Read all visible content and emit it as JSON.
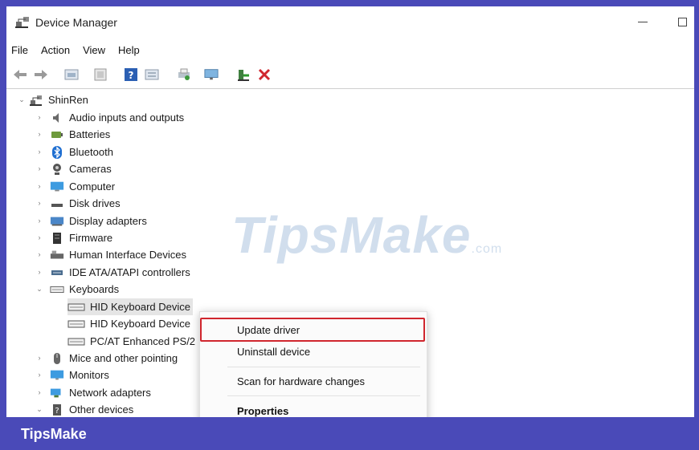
{
  "window": {
    "title": "Device Manager"
  },
  "menubar": [
    "File",
    "Action",
    "View",
    "Help"
  ],
  "toolbar": [
    "back-arrow-icon",
    "forward-arrow-icon",
    "properties-icon",
    "show-hide-icon",
    "help-icon",
    "view-icon",
    "print-icon",
    "monitor-icon",
    "enable-device-icon",
    "uninstall-icon"
  ],
  "tree": {
    "root": "ShinRen",
    "items": [
      {
        "label": "Audio inputs and outputs",
        "icon": "speaker-icon"
      },
      {
        "label": "Batteries",
        "icon": "battery-icon"
      },
      {
        "label": "Bluetooth",
        "icon": "bluetooth-icon"
      },
      {
        "label": "Cameras",
        "icon": "camera-icon"
      },
      {
        "label": "Computer",
        "icon": "computer-icon"
      },
      {
        "label": "Disk drives",
        "icon": "disk-icon"
      },
      {
        "label": "Display adapters",
        "icon": "display-adapter-icon"
      },
      {
        "label": "Firmware",
        "icon": "firmware-icon"
      },
      {
        "label": "Human Interface Devices",
        "icon": "hid-icon"
      },
      {
        "label": "IDE ATA/ATAPI controllers",
        "icon": "ide-icon"
      },
      {
        "label": "Keyboards",
        "icon": "keyboard-icon"
      },
      {
        "label": "Mice and other pointing",
        "icon": "mouse-icon"
      },
      {
        "label": "Monitors",
        "icon": "monitor-icon"
      },
      {
        "label": "Network adapters",
        "icon": "network-icon"
      },
      {
        "label": "Other devices",
        "icon": "other-devices-icon"
      }
    ],
    "keyboards": [
      "HID Keyboard Device",
      "HID Keyboard Device",
      "PC/AT Enhanced PS/2"
    ]
  },
  "watermark": {
    "main": "TipsMake",
    "suffix": ".com"
  },
  "context_menu": [
    "Update driver",
    "Uninstall device",
    "Scan for hardware changes",
    "Properties"
  ],
  "footer": {
    "brand": "TipsMake"
  },
  "colors": {
    "frame": "#4a4ab8",
    "highlight_border": "#d0262e"
  }
}
